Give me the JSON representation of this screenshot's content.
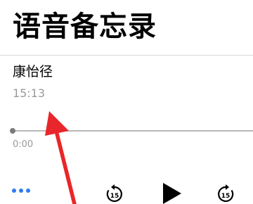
{
  "header": {
    "title": "语音备忘录"
  },
  "recording": {
    "name": "康怡径",
    "time": "15:13",
    "elapsed": "0:00",
    "progress": 0
  },
  "controls": {
    "skip_back_seconds": "15",
    "skip_forward_seconds": "15",
    "more_icon": "ellipsis-icon",
    "play_icon": "play-icon"
  },
  "colors": {
    "accent": "#2f7cf6",
    "annotation_arrow": "#e8262b",
    "secondary_text": "#9a9a9a"
  }
}
